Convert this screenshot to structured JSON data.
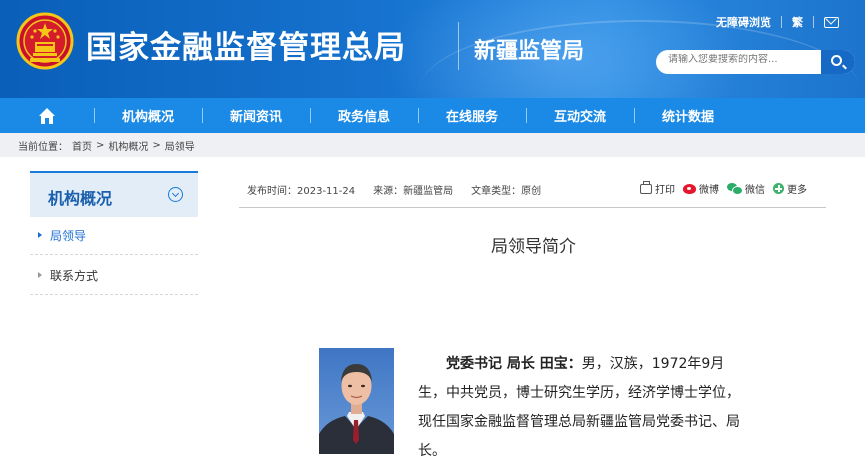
{
  "header": {
    "site_title": "国家金融监督管理总局",
    "branch_name": "新疆监管局",
    "top_links": {
      "accessibility": "无障碍浏览",
      "traditional": "繁"
    },
    "search_placeholder": "请输入您要搜索的内容..."
  },
  "nav": {
    "items": [
      "机构概况",
      "新闻资讯",
      "政务信息",
      "在线服务",
      "互动交流",
      "统计数据"
    ]
  },
  "breadcrumb": {
    "label": "当前位置：",
    "crumbs": [
      "首页",
      "机构概况",
      "局领导"
    ],
    "separator": ">"
  },
  "sidebar": {
    "title": "机构概况",
    "items": [
      {
        "label": "局领导",
        "active": true
      },
      {
        "label": "联系方式",
        "active": false
      }
    ]
  },
  "article": {
    "meta": {
      "published": "发布时间：2023-11-24",
      "source": "来源：新疆监管局",
      "type": "文章类型：原创"
    },
    "share": {
      "print": "打印",
      "weibo": "微博",
      "wechat": "微信",
      "more": "更多"
    },
    "title": "局领导简介",
    "bio_name": "党委书记 局长 田宝：",
    "bio_text": "男，汉族，1972年9月生，中共党员，博士研究生学历，经济学博士学位，现任国家金融监督管理总局新疆监管局党委书记、局长。"
  },
  "colors": {
    "header_blue": "#1673cf",
    "nav_blue": "#1a8ae6",
    "link_blue": "#1a6fd0",
    "weibo_red": "#e6162d",
    "wechat_green": "#2aae67"
  },
  "icons": [
    "national-emblem-icon",
    "mail-icon",
    "search-icon",
    "home-icon",
    "chevron-down-icon",
    "print-icon",
    "weibo-icon",
    "wechat-icon",
    "more-icon"
  ]
}
